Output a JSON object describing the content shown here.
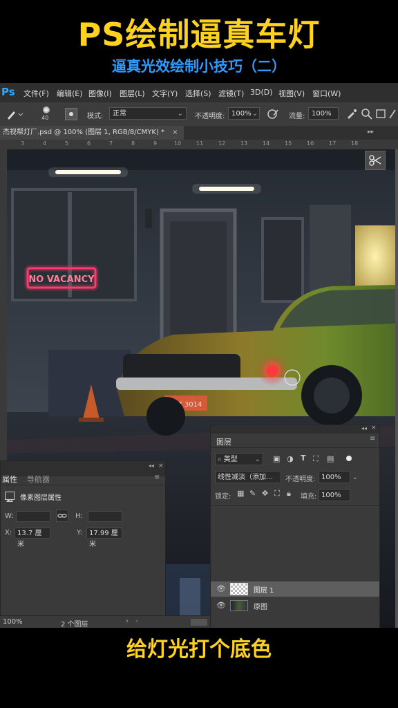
{
  "video": {
    "title": "PS绘制逼真车灯",
    "subtitle": "逼真光效绘制小技巧（二）",
    "caption": "给灯光打个底色"
  },
  "app": {
    "logo": "Ps",
    "menu": [
      "文件(F)",
      "编辑(E)",
      "图像(I)",
      "图层(L)",
      "文字(Y)",
      "选择(S)",
      "滤镜(T)",
      "3D(D)",
      "视图(V)",
      "窗口(W)"
    ],
    "options": {
      "brush_size": "40",
      "mode_label": "模式:",
      "mode_value": "正常",
      "opacity_label": "不透明度:",
      "opacity_value": "100%",
      "flow_label": "流量:",
      "flow_value": "100%"
    },
    "document_tab": "杰视帮灯厂.psd @ 100% (图层 1, RGB/8/CMYK) *",
    "ruler_ticks": [
      "3",
      "4",
      "5",
      "6",
      "7",
      "8",
      "9",
      "10",
      "11",
      "12",
      "13",
      "14",
      "15",
      "16",
      "17",
      "18"
    ],
    "scene": {
      "neon_sign": "NO VACANCY",
      "license_plate": "LLZ 3014"
    },
    "properties_panel": {
      "tab_active": "属性",
      "tab_inactive": "导航器",
      "subtitle": "像素图层属性",
      "w_label": "W:",
      "h_label": "H:",
      "x_label": "X:",
      "x_value": "13.7 厘米",
      "y_label": "Y:",
      "y_value": "17.99 厘米"
    },
    "layers_panel": {
      "tab": "图层",
      "filter_kind": "类型",
      "blend_mode": "线性减淡（添加...",
      "opacity_label": "不透明度:",
      "opacity_value": "100%",
      "lock_label": "锁定:",
      "fill_label": "填充:",
      "fill_value": "100%",
      "layers": [
        {
          "name": "图层 1",
          "selected": true
        },
        {
          "name": "原图",
          "selected": false
        }
      ]
    },
    "status_bar": {
      "zoom": "100%",
      "layer_count": "2 个图层"
    }
  }
}
